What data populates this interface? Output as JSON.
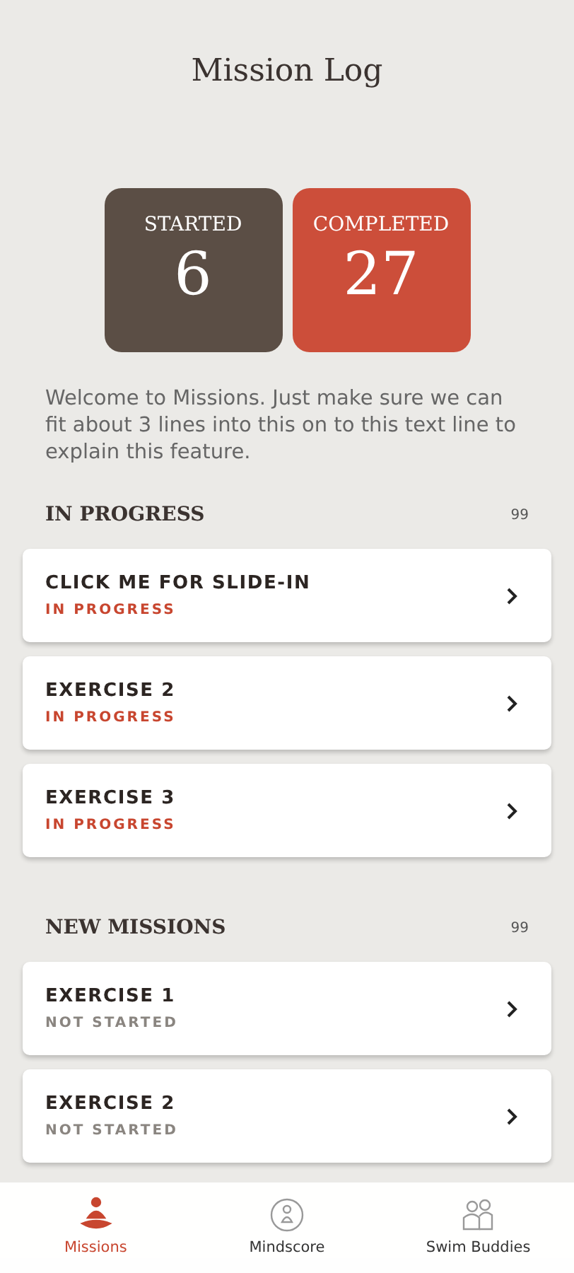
{
  "title": "Mission Log",
  "stats": [
    {
      "label": "STARTED",
      "value": "6",
      "kind": "started"
    },
    {
      "label": "COMPLETED",
      "value": "27",
      "kind": "completed"
    }
  ],
  "intro": "Welcome to Missions. Just make sure we can fit about 3 lines into this on to this text line to explain this feature.",
  "sections": [
    {
      "title": "IN PROGRESS",
      "count": "99",
      "items": [
        {
          "name": "CLICK ME FOR SLIDE-IN",
          "status": "IN PROGRESS",
          "kind": "in_progress"
        },
        {
          "name": "EXERCISE 2",
          "status": "IN PROGRESS",
          "kind": "in_progress"
        },
        {
          "name": "EXERCISE 3",
          "status": "IN PROGRESS",
          "kind": "in_progress"
        }
      ]
    },
    {
      "title": "NEW MISSIONS",
      "count": "99",
      "items": [
        {
          "name": "EXERCISE 1",
          "status": "NOT STARTED",
          "kind": "not_started"
        },
        {
          "name": "EXERCISE 2",
          "status": "NOT STARTED",
          "kind": "not_started"
        }
      ]
    }
  ],
  "nav": [
    {
      "label": "Missions",
      "kind": "missions",
      "selected": true
    },
    {
      "label": "Mindscore",
      "kind": "mindscore",
      "selected": false
    },
    {
      "label": "Swim Buddies",
      "kind": "buddies",
      "selected": false
    }
  ]
}
